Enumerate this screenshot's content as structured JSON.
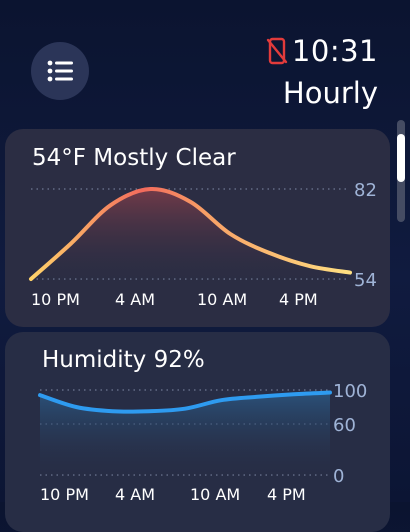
{
  "header": {
    "time": "10:31",
    "title": "Hourly",
    "status_icon": "phone-disconnected-icon",
    "menu_icon": "list-icon"
  },
  "colors": {
    "status_red": "#e23b3b",
    "temp_warm": "#f26a5c",
    "temp_cool": "#ffd36a",
    "humidity_blue": "#2e9bf0"
  },
  "cards": {
    "temperature": {
      "title": "54°F Mostly Clear",
      "chart_data": {
        "type": "area",
        "x": [
          0,
          3,
          6,
          9,
          12,
          15,
          18,
          21,
          24
        ],
        "values": [
          54,
          65,
          77,
          82,
          78,
          68,
          62,
          58,
          56
        ],
        "ylim": [
          54,
          82
        ],
        "ytick_labels": [
          "82",
          "54"
        ],
        "xtick_labels": [
          "10 PM",
          "4 AM",
          "10 AM",
          "4 PM"
        ]
      }
    },
    "humidity": {
      "title": "Humidity 92%",
      "chart_data": {
        "type": "area",
        "x": [
          0,
          3,
          6,
          9,
          12,
          15,
          18,
          21,
          24
        ],
        "values": [
          94,
          80,
          75,
          75,
          78,
          88,
          92,
          95,
          97
        ],
        "ylim": [
          0,
          100
        ],
        "ytick_labels": [
          "100",
          "60",
          "0"
        ],
        "xtick_labels": [
          "10 PM",
          "4 AM",
          "10 AM",
          "4 PM"
        ]
      }
    }
  }
}
